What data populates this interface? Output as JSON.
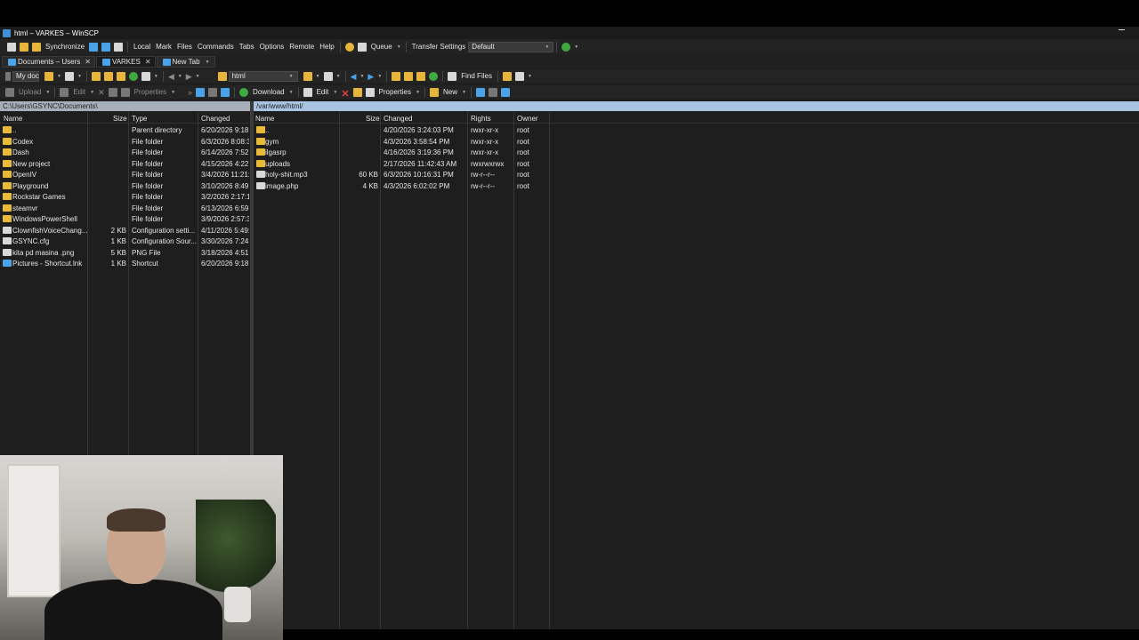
{
  "window": {
    "title": "html – VARKES – WinSCP"
  },
  "menu": {
    "synchronize": "Synchronize",
    "items": [
      "Local",
      "Mark",
      "Files",
      "Commands",
      "Tabs",
      "Options",
      "Remote",
      "Help"
    ],
    "queue": "Queue",
    "transfer_settings_label": "Transfer Settings",
    "transfer_settings_value": "Default"
  },
  "tabs": [
    {
      "label": "Documents – Users"
    },
    {
      "label": "VARKES"
    },
    {
      "label": "New Tab"
    }
  ],
  "local": {
    "drive_combo": "My doc",
    "path": "C:\\Users\\GSYNC\\Documents\\",
    "toolbar": {
      "upload": "Upload",
      "edit": "Edit",
      "properties": "Properties"
    },
    "columns": {
      "name": "Name",
      "size": "Size",
      "type": "Type",
      "changed": "Changed"
    },
    "files": [
      {
        "name": "..",
        "size": "",
        "type": "Parent directory",
        "changed": "6/20/2026 9:18:",
        "icon": "parent-folder-icon"
      },
      {
        "name": "Codex",
        "size": "",
        "type": "File folder",
        "changed": "6/3/2026 8:08:3",
        "icon": "folder-icon"
      },
      {
        "name": "Dash",
        "size": "",
        "type": "File folder",
        "changed": "6/14/2026 7:52:",
        "icon": "folder-icon"
      },
      {
        "name": "New project",
        "size": "",
        "type": "File folder",
        "changed": "4/15/2026 4:22:",
        "icon": "folder-icon"
      },
      {
        "name": "OpenIV",
        "size": "",
        "type": "File folder",
        "changed": "3/4/2026 11:21:",
        "icon": "folder-icon"
      },
      {
        "name": "Playground",
        "size": "",
        "type": "File folder",
        "changed": "3/10/2026 8:49:",
        "icon": "folder-icon"
      },
      {
        "name": "Rockstar Games",
        "size": "",
        "type": "File folder",
        "changed": "3/2/2026 2:17:1",
        "icon": "folder-icon"
      },
      {
        "name": "steamvr",
        "size": "",
        "type": "File folder",
        "changed": "6/13/2026 6:59:",
        "icon": "folder-icon"
      },
      {
        "name": "WindowsPowerShell",
        "size": "",
        "type": "File folder",
        "changed": "3/9/2026 2:57:3",
        "icon": "folder-icon"
      },
      {
        "name": "ClownfishVoiceChang...",
        "size": "2 KB",
        "type": "Configuration setti...",
        "changed": "4/11/2026 5:49:",
        "icon": "file-icon"
      },
      {
        "name": "GSYNC.cfg",
        "size": "1 KB",
        "type": "Configuration Sour...",
        "changed": "3/30/2026 7:24:",
        "icon": "file-icon"
      },
      {
        "name": "kita pd masina .png",
        "size": "5 KB",
        "type": "PNG File",
        "changed": "3/18/2026 4:51:",
        "icon": "file-icon"
      },
      {
        "name": "Pictures - Shortcut.lnk",
        "size": "1 KB",
        "type": "Shortcut",
        "changed": "6/20/2026 9:18:",
        "icon": "shortcut-icon"
      }
    ]
  },
  "remote": {
    "dir_combo": "html",
    "find_files": "Find Files",
    "path": "/var/www/html/",
    "toolbar": {
      "download": "Download",
      "edit": "Edit",
      "properties": "Properties",
      "new": "New"
    },
    "columns": {
      "name": "Name",
      "size": "Size",
      "changed": "Changed",
      "rights": "Rights",
      "owner": "Owner"
    },
    "files": [
      {
        "name": "..",
        "size": "",
        "changed": "4/20/2026 3:24:03 PM",
        "rights": "rwxr-xr-x",
        "owner": "root",
        "icon": "parent-folder-icon"
      },
      {
        "name": "gym",
        "size": "",
        "changed": "4/3/2026 3:58:54 PM",
        "rights": "rwxr-xr-x",
        "owner": "root",
        "icon": "folder-icon"
      },
      {
        "name": "ilgasrp",
        "size": "",
        "changed": "4/16/2026 3:19:36 PM",
        "rights": "rwxr-xr-x",
        "owner": "root",
        "icon": "folder-icon"
      },
      {
        "name": "uploads",
        "size": "",
        "changed": "2/17/2026 11:42:43 AM",
        "rights": "rwxrwxrwx",
        "owner": "root",
        "icon": "folder-icon"
      },
      {
        "name": "holy-shit.mp3",
        "size": "60 KB",
        "changed": "6/3/2026 10:16:31 PM",
        "rights": "rw-r--r--",
        "owner": "root",
        "icon": "file-icon"
      },
      {
        "name": "image.php",
        "size": "4 KB",
        "changed": "4/3/2026 6:02:02 PM",
        "rights": "rw-r--r--",
        "owner": "root",
        "icon": "file-icon"
      }
    ]
  },
  "colors": {
    "path_active": "#a9c4e0",
    "path_inactive": "#a7b0ba",
    "folder": "#e9b93a",
    "accent": "#4aa3e8"
  }
}
